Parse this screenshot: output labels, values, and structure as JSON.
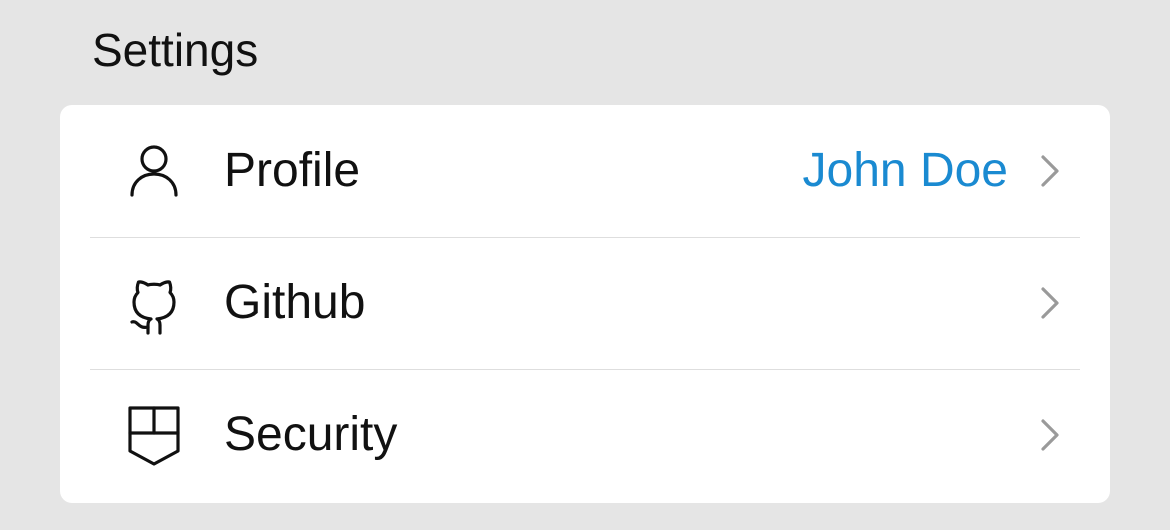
{
  "header": {
    "title": "Settings"
  },
  "colors": {
    "accent": "#1a8ad1",
    "chevron": "#9a9a9a",
    "text": "#111111",
    "background": "#e5e5e5",
    "card": "#ffffff"
  },
  "settings": {
    "items": [
      {
        "label": "Profile",
        "value": "John Doe",
        "icon": "person-icon"
      },
      {
        "label": "Github",
        "value": "",
        "icon": "github-icon"
      },
      {
        "label": "Security",
        "value": "",
        "icon": "shield-icon"
      }
    ]
  }
}
